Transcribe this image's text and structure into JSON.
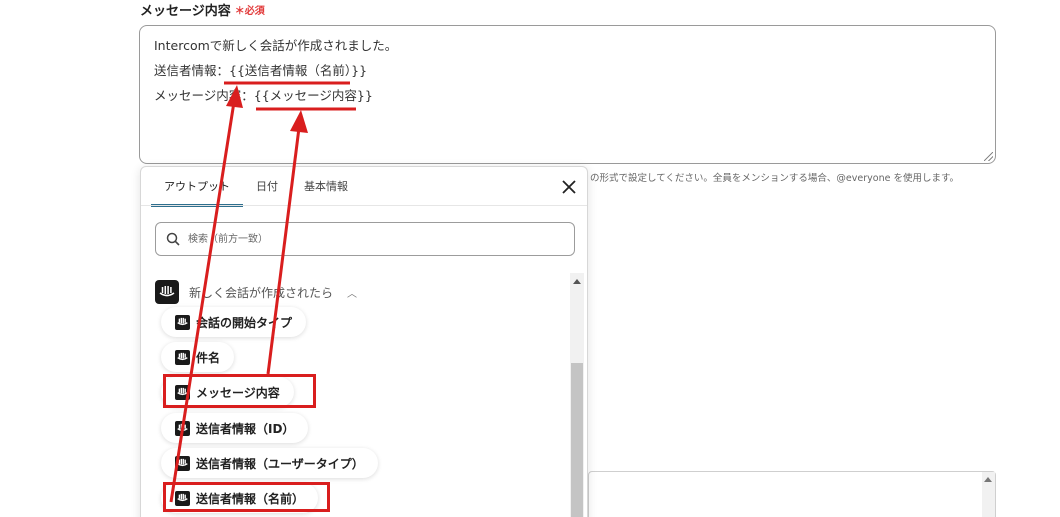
{
  "field": {
    "label": "メッセージ内容",
    "required_mark": "＊",
    "required_text": "必須"
  },
  "message": {
    "line1": "Intercomで新しく会話が作成されました。",
    "line2_prefix": "送信者情報：",
    "line2_var": "{{送信者情報（名前）}}",
    "line3_prefix": "メッセージ内容：",
    "line3_var": "{{メッセージ内容}}"
  },
  "hint": "の形式で設定してください。全員をメンションする場合、@everyone を使用します。",
  "popup": {
    "tabs": [
      {
        "label": "アウトプット",
        "active": true
      },
      {
        "label": "日付",
        "active": false
      },
      {
        "label": "基本情報",
        "active": false
      }
    ],
    "search_placeholder": "検索（前方一致）",
    "section_title": "新しく会話が作成されたら",
    "items": [
      "会話の開始タイプ",
      "件名",
      "メッセージ内容",
      "送信者情報（ID）",
      "送信者情報（ユーザータイプ）",
      "送信者情報（名前）"
    ]
  },
  "colors": {
    "annotation_red": "#d91e1e",
    "active_tab": "#2e6f8e",
    "required_red": "#e23b3b"
  },
  "icons": [
    "search-icon",
    "close-icon",
    "intercom-logo-icon",
    "chevron-up-icon",
    "scroll-up-arrow-icon"
  ]
}
